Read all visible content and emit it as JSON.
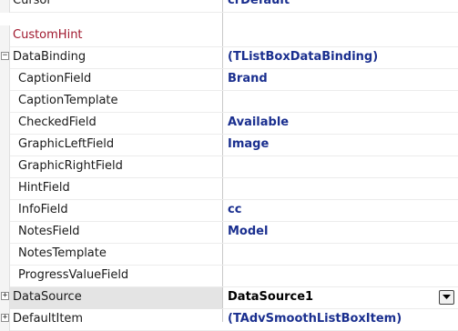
{
  "inspector": {
    "rows": [
      {
        "name": "Cursor",
        "value": "crDefault"
      },
      {
        "name": "CustomHint",
        "value": ""
      },
      {
        "name": "DataBinding",
        "value": "(TListBoxDataBinding)"
      },
      {
        "name": "CaptionField",
        "value": "Brand"
      },
      {
        "name": "CaptionTemplate",
        "value": ""
      },
      {
        "name": "CheckedField",
        "value": "Available"
      },
      {
        "name": "GraphicLeftField",
        "value": "Image"
      },
      {
        "name": "GraphicRightField",
        "value": ""
      },
      {
        "name": "HintField",
        "value": ""
      },
      {
        "name": "InfoField",
        "value": "cc"
      },
      {
        "name": "NotesField",
        "value": "Model"
      },
      {
        "name": "NotesTemplate",
        "value": ""
      },
      {
        "name": "ProgressValueField",
        "value": ""
      },
      {
        "name": "DataSource",
        "value": "DataSource1"
      },
      {
        "name": "DefaultItem",
        "value": "(TAdvSmoothListBoxItem)"
      }
    ],
    "expand_symbol_collapsed": "+",
    "expand_symbol_expanded": "−",
    "icons": {
      "dropdown": "chevron-down-icon"
    }
  }
}
